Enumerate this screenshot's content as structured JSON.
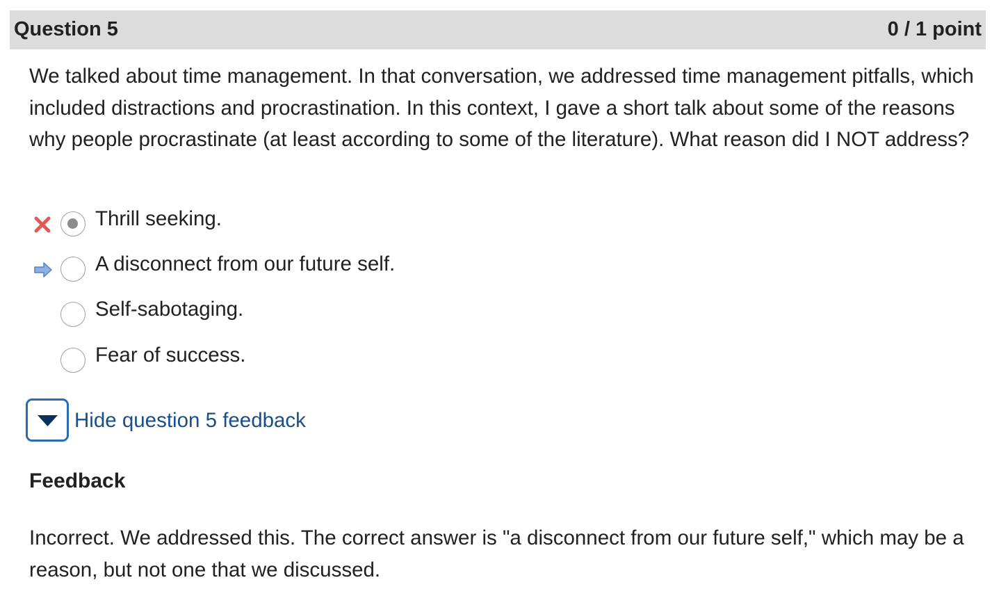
{
  "question": {
    "title": "Question 5",
    "points": "0 / 1 point",
    "prompt": "We talked about time management. In that conversation, we addressed time management pitfalls, which included distractions and procrastination. In this context, I gave a short talk about some of the reasons why people procrastinate (at least according to some of the literature). What reason did I NOT address?"
  },
  "options": [
    {
      "label": "Thrill seeking.",
      "selected": true,
      "marker": "incorrect-x-icon"
    },
    {
      "label": "A disconnect from our future self.",
      "selected": false,
      "marker": "correct-answer-arrow-icon"
    },
    {
      "label": "Self-sabotaging.",
      "selected": false,
      "marker": ""
    },
    {
      "label": "Fear of success.",
      "selected": false,
      "marker": ""
    }
  ],
  "feedback_toggle": {
    "label": "Hide question 5 feedback",
    "icon": "triangle-down-icon"
  },
  "feedback": {
    "heading": "Feedback",
    "text": "Incorrect. We addressed this. The correct answer is \"a disconnect from our future self,\" which may be a reason, but not one that we discussed."
  },
  "colors": {
    "header_bg": "#dcdcdc",
    "incorrect": "#e05a5a",
    "arrow": "#7a9bd6",
    "link": "#1a4e8a",
    "toggle_border": "#2b6cb0"
  }
}
